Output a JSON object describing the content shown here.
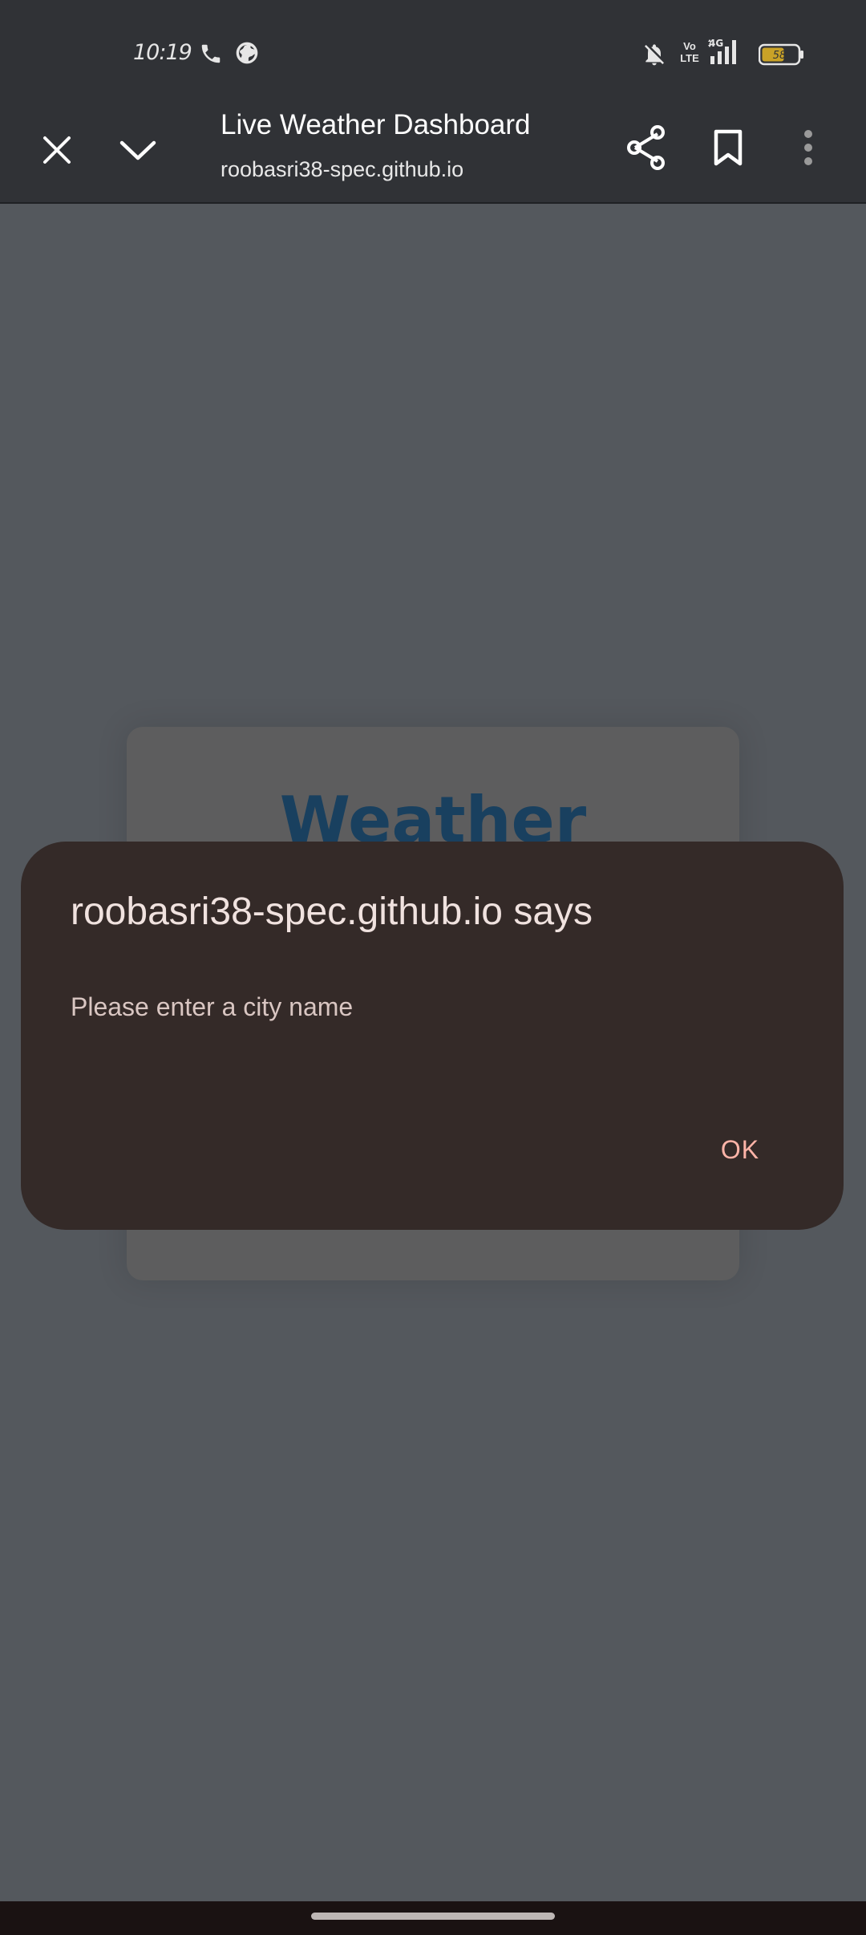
{
  "status_bar": {
    "time": "10:19",
    "network": "4G",
    "volte": "Vo LTE",
    "battery_level": "58",
    "icons": [
      "call-icon",
      "globe-icon",
      "mute-icon",
      "volte-icon",
      "signal-icon",
      "battery-icon"
    ]
  },
  "browser": {
    "title": "Live Weather Dashboard",
    "url": "roobasri38-spec.github.io",
    "icons": [
      "close-icon",
      "chevron-down-icon",
      "share-icon",
      "bookmark-icon",
      "more-vert-icon"
    ]
  },
  "page": {
    "heading": "Weather"
  },
  "dialog": {
    "title": "roobasri38-spec.github.io says",
    "message": "Please enter a city name",
    "ok_label": "OK"
  },
  "colors": {
    "accent": "#ffb4a8",
    "dialog_bg": "#342a28",
    "heading": "#19405f"
  }
}
